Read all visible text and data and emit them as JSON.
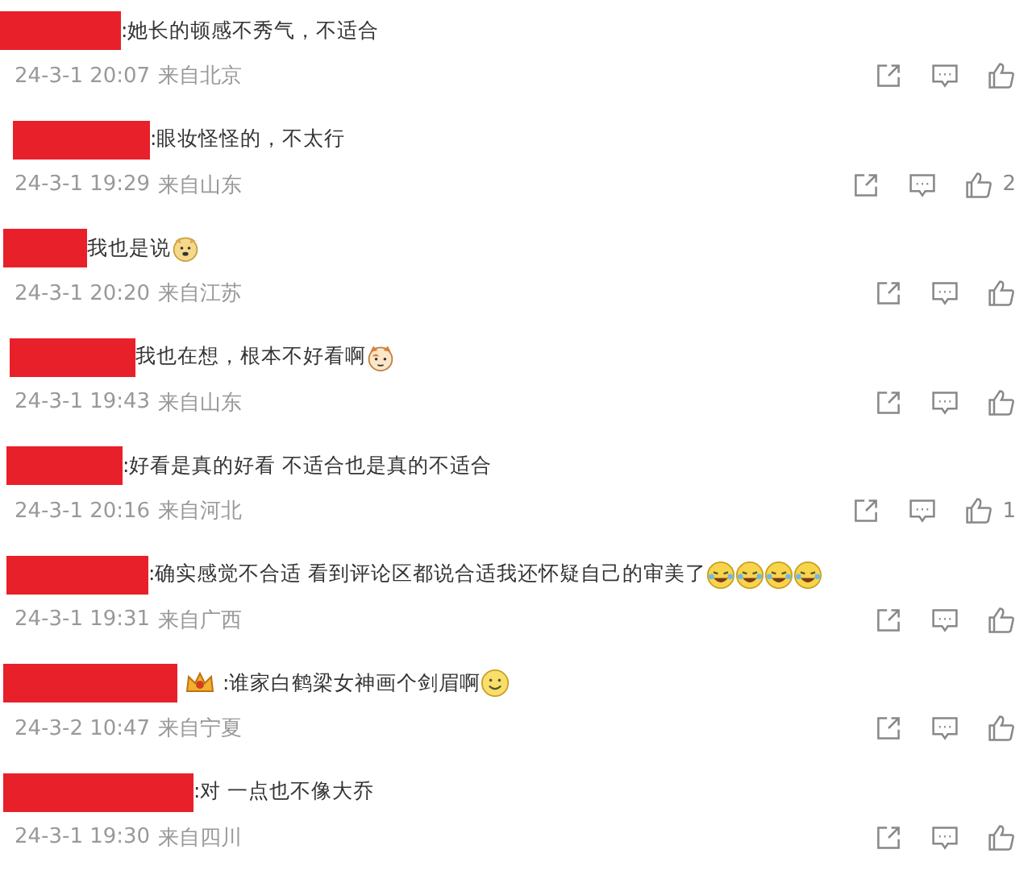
{
  "comments": [
    {
      "text": ":她长的顿感不秀气，不适合",
      "time": "24-3-1 20:07",
      "location": "来自北京"
    },
    {
      "text": ":眼妆怪怪的，不太行",
      "time": "24-3-1 19:29",
      "location": "来自山东",
      "likes": "2"
    },
    {
      "text": "我也是说",
      "emojis": [
        {
          "kind": "dog"
        }
      ],
      "time": "24-3-1 20:20",
      "location": "来自江苏"
    },
    {
      "text": "我也在想，根本不好看啊",
      "emojis": [
        {
          "kind": "cat"
        }
      ],
      "time": "24-3-1 19:43",
      "location": "来自山东"
    },
    {
      "text": ":好看是真的好看 不适合也是真的不适合",
      "time": "24-3-1 20:16",
      "location": "来自河北",
      "likes": "1"
    },
    {
      "text": ":确实感觉不合适 看到评论区都说合适我还怀疑自己的审美了",
      "emojis": [
        {
          "kind": "laugh"
        },
        {
          "kind": "laugh"
        },
        {
          "kind": "laugh"
        },
        {
          "kind": "laugh"
        }
      ],
      "time": "24-3-1 19:31",
      "location": "来自广西"
    },
    {
      "text": ":谁家白鹤梁女神画个剑眉啊",
      "badge": true,
      "emojis": [
        {
          "kind": "smile"
        }
      ],
      "time": "24-3-2 10:47",
      "location": "来自宁夏"
    },
    {
      "text": ":对 一点也不像大乔",
      "time": "24-3-1 19:30",
      "location": "来自四川"
    }
  ]
}
